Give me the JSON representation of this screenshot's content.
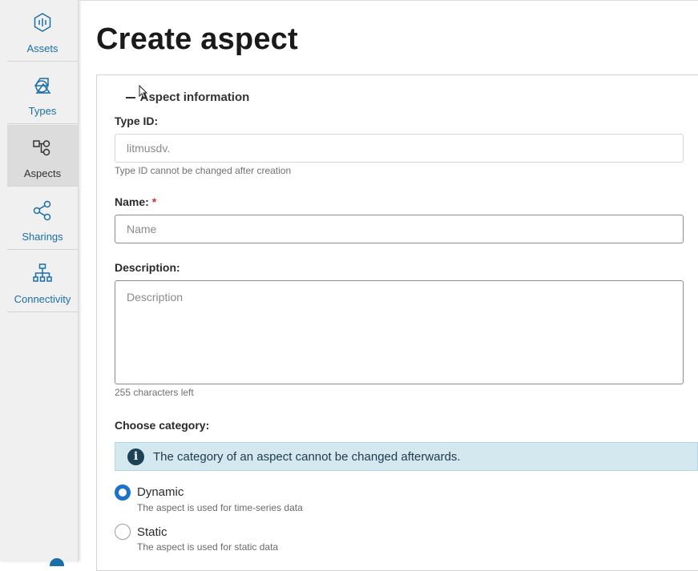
{
  "sidebar": {
    "items": [
      {
        "label": "Assets",
        "icon": "assets-icon"
      },
      {
        "label": "Types",
        "icon": "types-icon"
      },
      {
        "label": "Aspects",
        "icon": "aspects-icon",
        "active": true
      },
      {
        "label": "Sharings",
        "icon": "share-icon"
      },
      {
        "label": "Connectivity",
        "icon": "hierarchy-icon"
      }
    ]
  },
  "page": {
    "title": "Create aspect"
  },
  "section": {
    "title": "Aspect information"
  },
  "form": {
    "type_id": {
      "label": "Type ID:",
      "placeholder": "litmusdv.",
      "helper": "Type ID cannot be changed after creation"
    },
    "name": {
      "label": "Name:",
      "required_mark": "*",
      "placeholder": "Name"
    },
    "description": {
      "label": "Description:",
      "placeholder": "Description",
      "helper": "255 characters left"
    },
    "category": {
      "label": "Choose category:",
      "info": "The category of an aspect cannot be changed afterwards.",
      "options": [
        {
          "label": "Dynamic",
          "description": "The aspect is used for time-series data",
          "selected": true
        },
        {
          "label": "Static",
          "description": "The aspect is used for static data",
          "selected": false
        }
      ]
    }
  },
  "colors": {
    "accent": "#1a73c8",
    "link": "#1a6fa8",
    "info_bg": "#d4e8f0",
    "required": "#c0392b"
  }
}
